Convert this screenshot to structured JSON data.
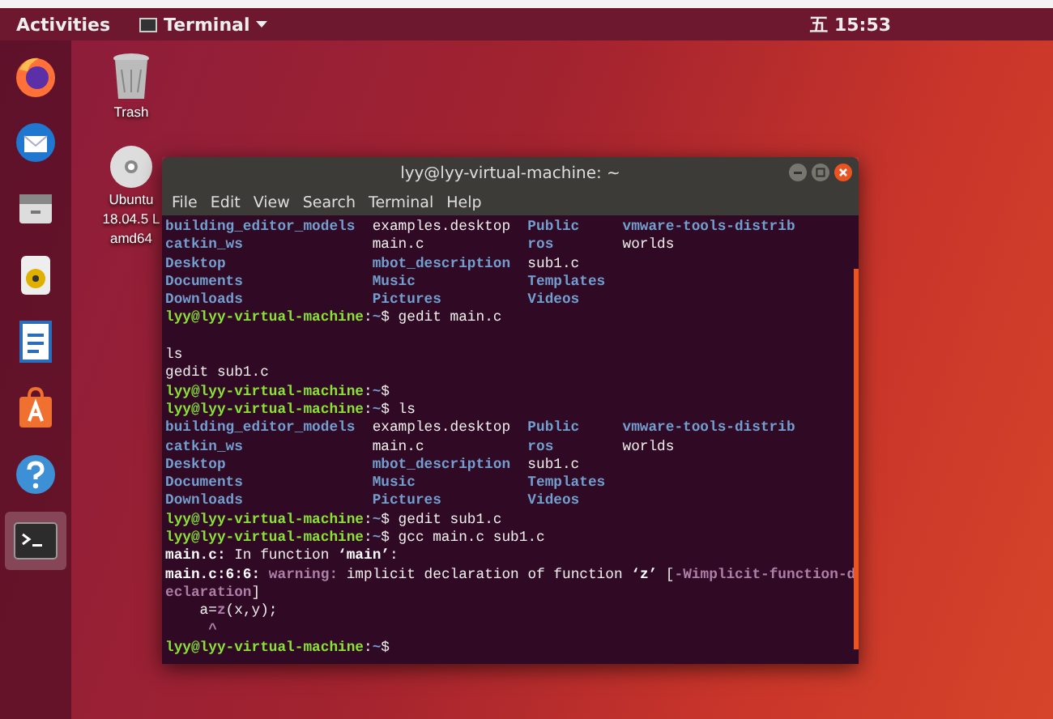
{
  "top_bar": {
    "activities": "Activities",
    "app_menu": "Terminal",
    "clock": "五 15:53"
  },
  "dock": [
    {
      "kind": "firefox",
      "selected": false
    },
    {
      "kind": "mail",
      "selected": false
    },
    {
      "kind": "files",
      "selected": false
    },
    {
      "kind": "speaker",
      "selected": false
    },
    {
      "kind": "writer",
      "selected": false
    },
    {
      "kind": "store",
      "selected": false
    },
    {
      "kind": "help",
      "selected": false
    },
    {
      "kind": "terminal",
      "selected": true
    }
  ],
  "desktop_icons": [
    {
      "kind": "trash",
      "lines": [
        "Trash"
      ]
    },
    {
      "kind": "disc",
      "lines": [
        "Ubuntu",
        "18.04.5 L",
        "amd64"
      ]
    }
  ],
  "terminal": {
    "title": "lyy@lyy-virtual-machine: ~",
    "menu": [
      "File",
      "Edit",
      "View",
      "Search",
      "Terminal",
      "Help"
    ],
    "lines": [
      {
        "kind": "listing",
        "rows": [
          [
            {
              "text": "building_editor_models",
              "kind": "dir"
            },
            {
              "text": "examples.desktop",
              "kind": "file"
            },
            {
              "text": "Public",
              "kind": "dir"
            },
            {
              "text": "vmware-tools-distrib",
              "kind": "dir"
            }
          ],
          [
            {
              "text": "catkin_ws",
              "kind": "dir"
            },
            {
              "text": "main.c",
              "kind": "file"
            },
            {
              "text": "ros",
              "kind": "dir"
            },
            {
              "text": "worlds",
              "kind": "file"
            }
          ],
          [
            {
              "text": "Desktop",
              "kind": "dir"
            },
            {
              "text": "mbot_description",
              "kind": "dir"
            },
            {
              "text": "sub1.c",
              "kind": "file"
            }
          ],
          [
            {
              "text": "Documents",
              "kind": "dir"
            },
            {
              "text": "Music",
              "kind": "dir"
            },
            {
              "text": "Templates",
              "kind": "dir"
            }
          ],
          [
            {
              "text": "Downloads",
              "kind": "dir"
            },
            {
              "text": "Pictures",
              "kind": "dir"
            },
            {
              "text": "Videos",
              "kind": "dir"
            }
          ]
        ]
      },
      {
        "kind": "text",
        "segments": [
          {
            "kind": "user",
            "text": "lyy@lyy-virtual-machine"
          },
          {
            "kind": "plain",
            "text": ":"
          },
          {
            "kind": "path",
            "text": "~"
          },
          {
            "kind": "plain",
            "text": "$ gedit main.c"
          }
        ]
      },
      {
        "kind": "blank"
      },
      {
        "kind": "text",
        "segments": [
          {
            "kind": "plain",
            "text": "ls"
          }
        ]
      },
      {
        "kind": "text",
        "segments": [
          {
            "kind": "plain",
            "text": "gedit sub1.c"
          }
        ]
      },
      {
        "kind": "text",
        "segments": [
          {
            "kind": "user",
            "text": "lyy@lyy-virtual-machine"
          },
          {
            "kind": "plain",
            "text": ":"
          },
          {
            "kind": "path",
            "text": "~"
          },
          {
            "kind": "plain",
            "text": "$"
          }
        ]
      },
      {
        "kind": "text",
        "segments": [
          {
            "kind": "user",
            "text": "lyy@lyy-virtual-machine"
          },
          {
            "kind": "plain",
            "text": ":"
          },
          {
            "kind": "path",
            "text": "~"
          },
          {
            "kind": "plain",
            "text": "$ ls"
          }
        ]
      },
      {
        "kind": "listing",
        "rows": [
          [
            {
              "text": "building_editor_models",
              "kind": "dir"
            },
            {
              "text": "examples.desktop",
              "kind": "file"
            },
            {
              "text": "Public",
              "kind": "dir"
            },
            {
              "text": "vmware-tools-distrib",
              "kind": "dir"
            }
          ],
          [
            {
              "text": "catkin_ws",
              "kind": "dir"
            },
            {
              "text": "main.c",
              "kind": "file"
            },
            {
              "text": "ros",
              "kind": "dir"
            },
            {
              "text": "worlds",
              "kind": "file"
            }
          ],
          [
            {
              "text": "Desktop",
              "kind": "dir"
            },
            {
              "text": "mbot_description",
              "kind": "dir"
            },
            {
              "text": "sub1.c",
              "kind": "file"
            }
          ],
          [
            {
              "text": "Documents",
              "kind": "dir"
            },
            {
              "text": "Music",
              "kind": "dir"
            },
            {
              "text": "Templates",
              "kind": "dir"
            }
          ],
          [
            {
              "text": "Downloads",
              "kind": "dir"
            },
            {
              "text": "Pictures",
              "kind": "dir"
            },
            {
              "text": "Videos",
              "kind": "dir"
            }
          ]
        ]
      },
      {
        "kind": "text",
        "segments": [
          {
            "kind": "user",
            "text": "lyy@lyy-virtual-machine"
          },
          {
            "kind": "plain",
            "text": ":"
          },
          {
            "kind": "path",
            "text": "~"
          },
          {
            "kind": "plain",
            "text": "$ gedit sub1.c"
          }
        ]
      },
      {
        "kind": "text",
        "segments": [
          {
            "kind": "user",
            "text": "lyy@lyy-virtual-machine"
          },
          {
            "kind": "plain",
            "text": ":"
          },
          {
            "kind": "path",
            "text": "~"
          },
          {
            "kind": "plain",
            "text": "$ gcc main.c sub1.c"
          }
        ]
      },
      {
        "kind": "text",
        "segments": [
          {
            "kind": "bold",
            "text": "main.c:"
          },
          {
            "kind": "plain",
            "text": " In function "
          },
          {
            "kind": "bold",
            "text": "‘main’"
          },
          {
            "kind": "plain",
            "text": ":"
          }
        ]
      },
      {
        "kind": "text",
        "segments": [
          {
            "kind": "bold",
            "text": "main.c:6:6:"
          },
          {
            "kind": "magenta",
            "text": " warning:"
          },
          {
            "kind": "plain",
            "text": " implicit declaration of function "
          },
          {
            "kind": "bold",
            "text": "‘z’"
          },
          {
            "kind": "plain",
            "text": " ["
          },
          {
            "kind": "magenta",
            "text": "-Wimplicit-function-d"
          }
        ]
      },
      {
        "kind": "text",
        "segments": [
          {
            "kind": "magenta",
            "text": "eclaration"
          },
          {
            "kind": "plain",
            "text": "]"
          }
        ]
      },
      {
        "kind": "text",
        "segments": [
          {
            "kind": "plain",
            "text": "    a="
          },
          {
            "kind": "magenta",
            "text": "z"
          },
          {
            "kind": "plain",
            "text": "(x,y);"
          }
        ]
      },
      {
        "kind": "text",
        "segments": [
          {
            "kind": "magenta",
            "text": "     ^"
          }
        ]
      },
      {
        "kind": "text",
        "segments": [
          {
            "kind": "user",
            "text": "lyy@lyy-virtual-machine"
          },
          {
            "kind": "plain",
            "text": ":"
          },
          {
            "kind": "path",
            "text": "~"
          },
          {
            "kind": "plain",
            "text": "$"
          }
        ]
      }
    ]
  }
}
